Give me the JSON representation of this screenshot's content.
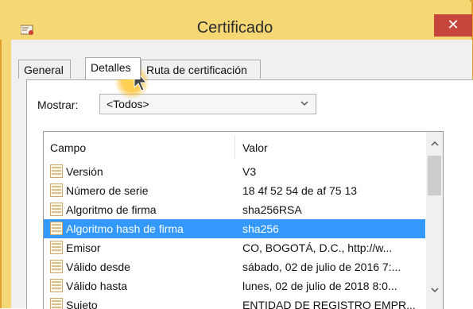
{
  "window": {
    "title": "Certificado",
    "close_glyph": "✕"
  },
  "tabs": [
    {
      "label": "General"
    },
    {
      "label": "Detalles"
    },
    {
      "label": "Ruta de certificación"
    }
  ],
  "filter": {
    "label": "Mostrar:",
    "selected": "<Todos>"
  },
  "list": {
    "columns": {
      "campo": "Campo",
      "valor": "Valor"
    },
    "rows": [
      {
        "campo": "Versión",
        "valor": "V3"
      },
      {
        "campo": "Número de serie",
        "valor": "18 4f 52 54 de af 75 13"
      },
      {
        "campo": "Algoritmo de firma",
        "valor": "sha256RSA"
      },
      {
        "campo": "Algoritmo hash de firma",
        "valor": "sha256"
      },
      {
        "campo": "Emisor",
        "valor": "CO, BOGOTÁ, D.C., http://w..."
      },
      {
        "campo": "Válido desde",
        "valor": "sábado, 02 de julio de 2016 7:..."
      },
      {
        "campo": "Válido hasta",
        "valor": "lunes, 02 de julio de 2018 8:0..."
      },
      {
        "campo": "Sujeto",
        "valor": "ENTIDAD DE REGISTRO EMPR..."
      }
    ],
    "selected_index": 3
  },
  "colors": {
    "titlebar": "#f5d874",
    "close": "#c7463c",
    "selection": "#3399ff"
  },
  "icons": {
    "app": "certificate-icon",
    "row": "field-icon",
    "cursor": "mouse-pointer-icon"
  }
}
